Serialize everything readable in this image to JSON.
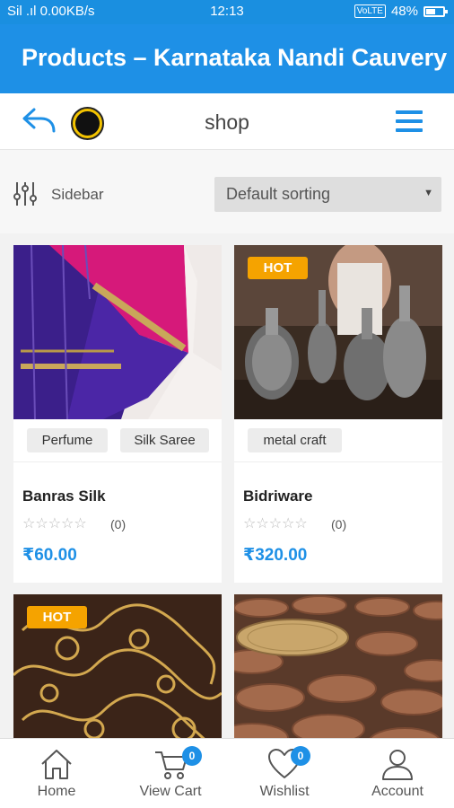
{
  "status_bar": {
    "left": "Sil .ıl 0.00KB/s",
    "time": "12:13",
    "volte": "VoLTE",
    "battery": "48%"
  },
  "app_bar": {
    "title": "Products – Karnataka Nandi Cauvery"
  },
  "nav_row": {
    "title": "shop"
  },
  "filter_row": {
    "sidebar_label": "Sidebar",
    "sort_value": "Default sorting"
  },
  "products": [
    {
      "name": "Banras Silk",
      "tags": [
        "Perfume",
        "Silk Saree"
      ],
      "hot": "",
      "rating_count": "(0)",
      "price": "₹60.00"
    },
    {
      "name": "Bidriware",
      "tags": [
        "metal craft"
      ],
      "hot": "HOT",
      "rating_count": "(0)",
      "price": "₹320.00"
    },
    {
      "name": "",
      "tags": [],
      "hot": "HOT",
      "rating_count": "",
      "price": ""
    },
    {
      "name": "",
      "tags": [],
      "hot": "",
      "rating_count": "",
      "price": ""
    }
  ],
  "bottom_nav": [
    {
      "label": "Home",
      "icon": "home-icon"
    },
    {
      "label": "View Cart",
      "icon": "cart-icon",
      "badge": "0"
    },
    {
      "label": "Wishlist",
      "icon": "heart-icon",
      "badge": "0"
    },
    {
      "label": "Account",
      "icon": "user-icon"
    }
  ],
  "colors": {
    "primary": "#1e90e6",
    "hot_badge": "#f5a300",
    "price": "#1e90e6"
  }
}
